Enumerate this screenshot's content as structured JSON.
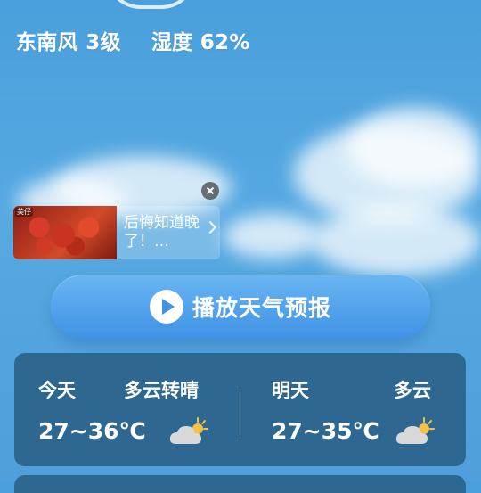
{
  "weather": {
    "wind": "东南风 3级",
    "humidity": "湿度 62%"
  },
  "ad": {
    "badge": "美仔",
    "text": "后悔知道晚了！…"
  },
  "play_button": {
    "label": "播放天气预报"
  },
  "forecast": {
    "today": {
      "day": "今天",
      "condition": "多云转晴",
      "temp": "27~36℃",
      "icon": "partly-cloudy-icon"
    },
    "tomorrow": {
      "day": "明天",
      "condition": "多云",
      "temp": "27~35℃",
      "icon": "partly-cloudy-icon"
    }
  }
}
